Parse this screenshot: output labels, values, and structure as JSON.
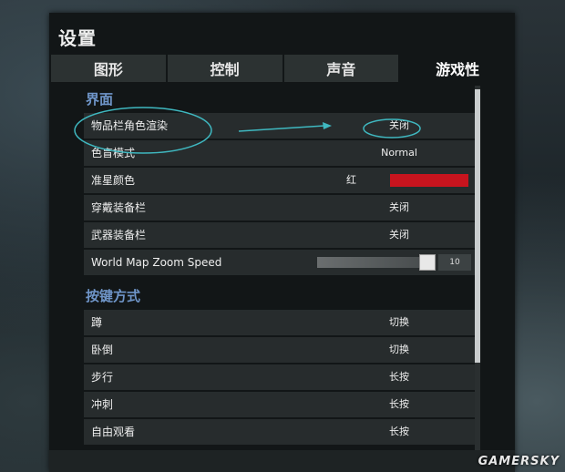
{
  "window": {
    "title": "设置"
  },
  "tabs": [
    {
      "label": "图形"
    },
    {
      "label": "控制"
    },
    {
      "label": "声音"
    },
    {
      "label": "游戏性",
      "active": true
    }
  ],
  "sections": {
    "interface": {
      "title": "界面",
      "rows": {
        "inventory_render": {
          "label": "物品栏角色渲染",
          "value": "关闭"
        },
        "colorblind": {
          "label": "色盲模式",
          "value": "Normal"
        },
        "crosshair_color": {
          "label": "准星颜色",
          "value": "红",
          "color": "#c8141e"
        },
        "wear_equipment": {
          "label": "穿戴装备栏",
          "value": "关闭"
        },
        "weapon_equipment": {
          "label": "武器装备栏",
          "value": "关闭"
        },
        "world_map_zoom": {
          "label": "World Map Zoom Speed",
          "value": "10",
          "level": 10
        }
      }
    },
    "keybind": {
      "title": "按键方式",
      "rows": {
        "crouch": {
          "label": "蹲",
          "value": "切换"
        },
        "prone": {
          "label": "卧倒",
          "value": "切换"
        },
        "walk": {
          "label": "步行",
          "value": "长按"
        },
        "sprint": {
          "label": "冲刺",
          "value": "长按"
        },
        "freelook": {
          "label": "自由观看",
          "value": "长按"
        }
      }
    }
  },
  "watermark": "GAMERSKY",
  "colors": {
    "accent_section": "#6f95c8",
    "annotation": "#3fb8c0",
    "panel_bg": "#121617",
    "row_bg": "#272c2d"
  }
}
